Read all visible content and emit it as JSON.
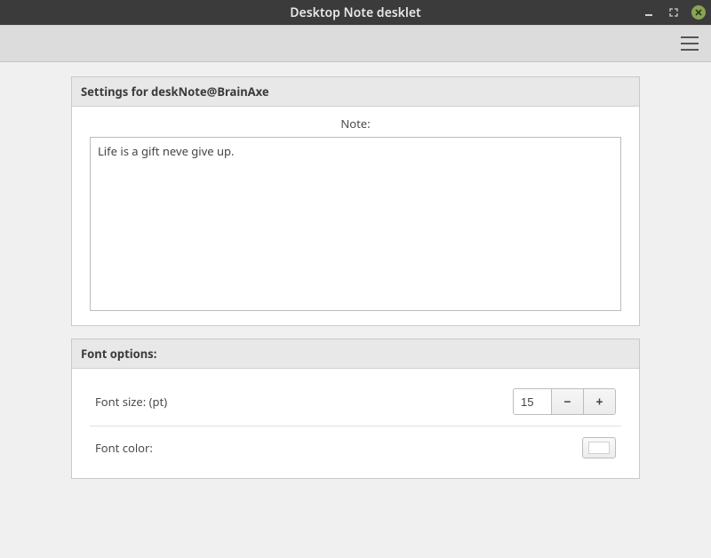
{
  "window": {
    "title": "Desktop Note desklet"
  },
  "panels": {
    "settings": {
      "header": "Settings for deskNote@BrainAxe",
      "note_label": "Note:",
      "note_value": "Life is a gift neve give up."
    },
    "font": {
      "header": "Font options:",
      "size_label": "Font size: (pt)",
      "size_value": "15",
      "minus_label": "−",
      "plus_label": "+",
      "color_label": "Font color:",
      "color_value": "#ffffff"
    }
  }
}
